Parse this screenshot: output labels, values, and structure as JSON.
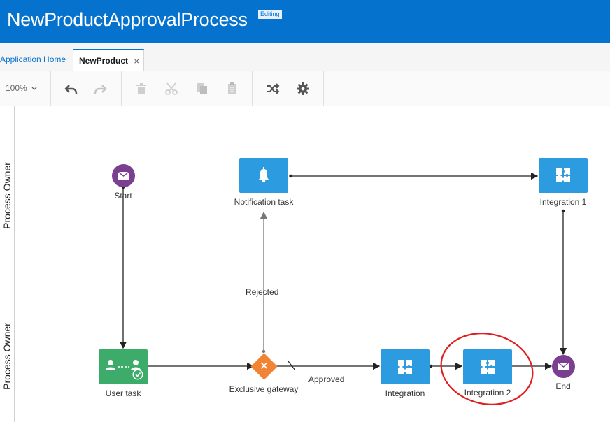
{
  "app": {
    "title": "NewProductApprovalProcess",
    "badge": "Editing"
  },
  "tabs": [
    {
      "label": "Application Home"
    },
    {
      "label": "NewProduct",
      "close": "×"
    }
  ],
  "toolbar": {
    "zoom": "100%",
    "icons": [
      "undo-icon",
      "redo-icon",
      "delete-icon",
      "cut-icon",
      "copy-icon",
      "paste-icon",
      "shuffle-icon",
      "gear-icon"
    ]
  },
  "lanes": [
    {
      "label": "Process Owner"
    },
    {
      "label": "Process Owner"
    }
  ],
  "nodes": {
    "start": {
      "label": "Start",
      "type": "message-start-event"
    },
    "notification": {
      "label": "Notification task",
      "type": "notification-task"
    },
    "integration1": {
      "label": "Integration 1",
      "type": "integration-task"
    },
    "usertask": {
      "label": "User task",
      "type": "user-task"
    },
    "gateway": {
      "label": "Exclusive gateway",
      "type": "exclusive-gateway"
    },
    "integration": {
      "label": "Integration",
      "type": "integration-task"
    },
    "integration2": {
      "label": "Integration 2",
      "type": "integration-task",
      "highlighted": true
    },
    "end": {
      "label": "End",
      "type": "message-end-event"
    }
  },
  "flows": {
    "rejected": "Rejected",
    "approved": "Approved"
  },
  "colors": {
    "brand": "#0572ce",
    "task": "#2d9be0",
    "user_task": "#3dab6a",
    "event": "#7a3f91",
    "gateway": "#f08434",
    "annotation": "#e01e1e"
  }
}
